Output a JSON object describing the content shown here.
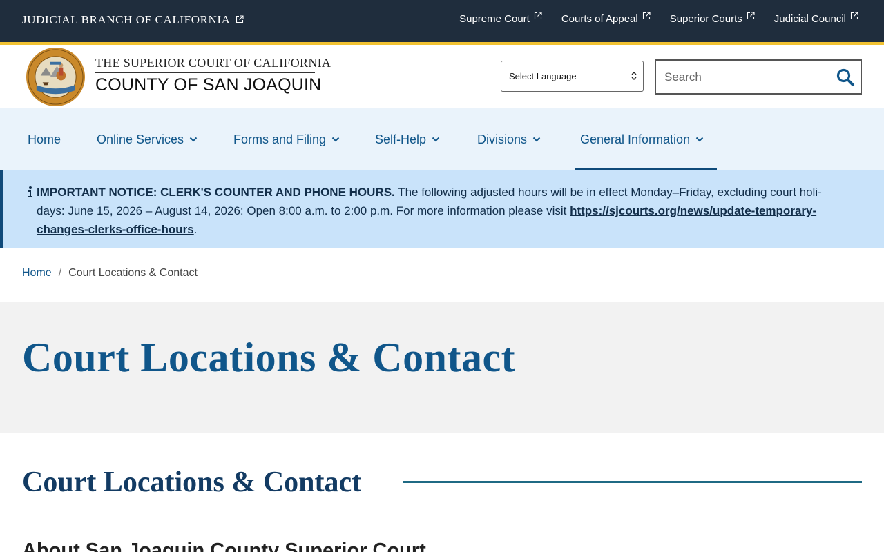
{
  "topbar": {
    "branch_label": "JUDICIAL BRANCH OF CALIFORNIA",
    "links": [
      {
        "label": "Supreme Court"
      },
      {
        "label": "Courts of Appeal"
      },
      {
        "label": "Superior Courts"
      },
      {
        "label": "Judicial Council"
      }
    ],
    "colors": {
      "background": "#1f2d3d",
      "accent": "#f1c232"
    }
  },
  "header": {
    "title_top": "THE SUPERIOR COURT OF CALIFORNIA",
    "title_main": "COUNTY OF SAN JOAQUIN",
    "seal_icon": "court-seal-icon",
    "language_select": {
      "selected": "Select Language"
    },
    "search": {
      "placeholder": "Search",
      "value": ""
    }
  },
  "nav": {
    "items": [
      {
        "label": "Home",
        "has_dropdown": false
      },
      {
        "label": "Online Services",
        "has_dropdown": true
      },
      {
        "label": "Forms and Filing",
        "has_dropdown": true
      },
      {
        "label": "Self-Help",
        "has_dropdown": true
      },
      {
        "label": "Divisions",
        "has_dropdown": true
      },
      {
        "label": "General Information",
        "has_dropdown": true,
        "active": true
      }
    ],
    "colors": {
      "background": "#eaf3fb",
      "text": "#10568a",
      "active": "#0f4a7a"
    }
  },
  "notice": {
    "lead": "IMPORTANT NOTICE: CLERK'S COUNTER AND PHONE HOURS.",
    "body": " The following adjusted hours will be in effect Monday–Friday, excluding court holi-days: June 15, 2026 – August 14, 2026: Open 8:00 a.m. to 2:00 p.m. For more information please visit ",
    "link": "https://sjcourts.org/news/update-temporary-changes-clerks-office-hours",
    "tail": ".",
    "colors": {
      "background": "#c9e3fa",
      "border": "#0f4a7a"
    }
  },
  "breadcrumb": {
    "home": "Home",
    "separator": "/",
    "current": "Court Locations & Contact"
  },
  "hero": {
    "title": "Court Locations & Contact"
  },
  "section": {
    "title": "Court Locations & Contact",
    "subtitle": "About San Joaquin County Superior Court"
  }
}
